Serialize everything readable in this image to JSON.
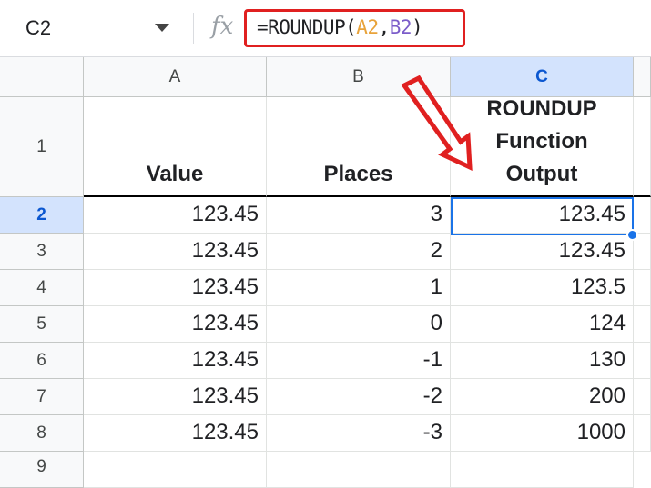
{
  "name_box": {
    "value": "C2"
  },
  "formula": {
    "fx_label": "fx",
    "prefix": "=ROUNDUP(",
    "arg1": "A2",
    "comma": ",",
    "arg2": "B2",
    "suffix": ")"
  },
  "sheet": {
    "columns": [
      "A",
      "B",
      "C"
    ],
    "row_numbers": [
      "1",
      "2",
      "3",
      "4",
      "5",
      "6",
      "7",
      "8",
      "9"
    ],
    "selected_cell": "C2",
    "headers": {
      "a": "Value",
      "b": "Places",
      "c_line1": "ROUNDUP",
      "c_line2": "Function",
      "c_line3": "Output"
    },
    "rows": [
      {
        "a": "123.45",
        "b": "3",
        "c": "123.45"
      },
      {
        "a": "123.45",
        "b": "2",
        "c": "123.45"
      },
      {
        "a": "123.45",
        "b": "1",
        "c": "123.5"
      },
      {
        "a": "123.45",
        "b": "0",
        "c": "124"
      },
      {
        "a": "123.45",
        "b": "-1",
        "c": "130"
      },
      {
        "a": "123.45",
        "b": "-2",
        "c": "200"
      },
      {
        "a": "123.45",
        "b": "-3",
        "c": "1000"
      }
    ]
  },
  "colors": {
    "annotation_red": "#e02020",
    "selection_blue": "#1a73e8",
    "header_selected": "#d3e3fd"
  }
}
